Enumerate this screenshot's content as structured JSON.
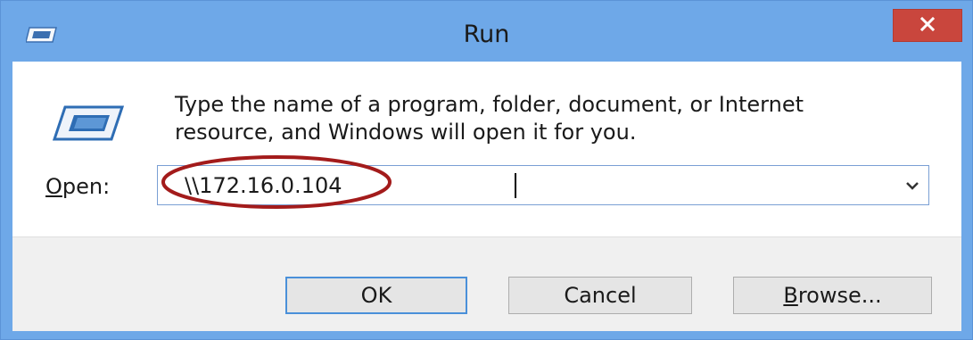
{
  "window": {
    "title": "Run",
    "close_icon": "close-icon",
    "app_icon": "run-app-icon"
  },
  "content": {
    "description_line1": "Type the name of a program, folder, document, or Internet",
    "description_line2": "resource, and Windows will open it for you.",
    "open_label_accel": "O",
    "open_label_rest": "pen:",
    "open_value": "\\\\172.16.0.104",
    "dropdown_icon": "chevron-down-icon"
  },
  "buttons": {
    "ok": "OK",
    "cancel": "Cancel",
    "browse_accel": "B",
    "browse_rest": "rowse..."
  },
  "colors": {
    "titlebar": "#6ea8e8",
    "close_button": "#c9463d",
    "highlight": "#a31b1b",
    "default_button_border": "#4a90d9"
  }
}
